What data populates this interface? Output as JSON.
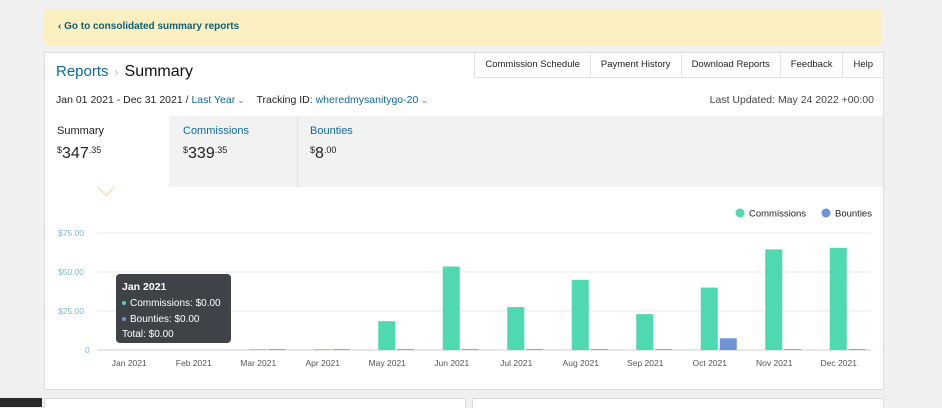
{
  "banner": {
    "link": "‹ Go to consolidated summary reports"
  },
  "breadcrumb": {
    "reports": "Reports",
    "sep": "›",
    "current": "Summary"
  },
  "nav": [
    "Commission Schedule",
    "Payment History",
    "Download Reports",
    "Feedback",
    "Help"
  ],
  "filters": {
    "date_range": "Jan 01 2021 - Dec 31 2021 /",
    "period": "Last Year",
    "tracking_label": "Tracking ID:",
    "tracking_id": "wheredmysanitygo-20",
    "chevron": "⌄"
  },
  "last_updated": "Last Updated: May 24 2022 +00:00",
  "tabs": [
    {
      "label": "Summary",
      "currency": "$",
      "whole": "347",
      "cents": ".35"
    },
    {
      "label": "Commissions",
      "currency": "$",
      "whole": "339",
      "cents": ".35"
    },
    {
      "label": "Bounties",
      "currency": "$",
      "whole": "8",
      "cents": ".00"
    }
  ],
  "tooltip": {
    "title": "Jan 2021",
    "commissions": "Commissions: $0.00",
    "bounties": "Bounties: $0.00",
    "total": "Total: $0.00"
  },
  "colors": {
    "commissions": "#4fd9b0",
    "bounties": "#6b93d6",
    "link": "#0d6b9a"
  },
  "chart_data": {
    "type": "bar",
    "categories": [
      "Jan 2021",
      "Feb 2021",
      "Mar 2021",
      "Apr 2021",
      "May 2021",
      "Jun 2021",
      "Jul 2021",
      "Aug 2021",
      "Sep 2021",
      "Oct 2021",
      "Nov 2021",
      "Dec 2021"
    ],
    "series": [
      {
        "name": "Commissions",
        "values": [
          0,
          0,
          0.5,
          0.5,
          18.5,
          53.5,
          27.5,
          45,
          23,
          40,
          64.5,
          65.5
        ]
      },
      {
        "name": "Bounties",
        "values": [
          0,
          0,
          0.5,
          0.5,
          0.5,
          0.5,
          0.5,
          0.5,
          0.5,
          7.5,
          0.5,
          0.5
        ]
      }
    ],
    "yticks": [
      "0",
      "$25.00",
      "$50.00",
      "$75.00"
    ],
    "ylim": [
      0,
      75
    ],
    "legend": "top-right",
    "grid": true
  }
}
